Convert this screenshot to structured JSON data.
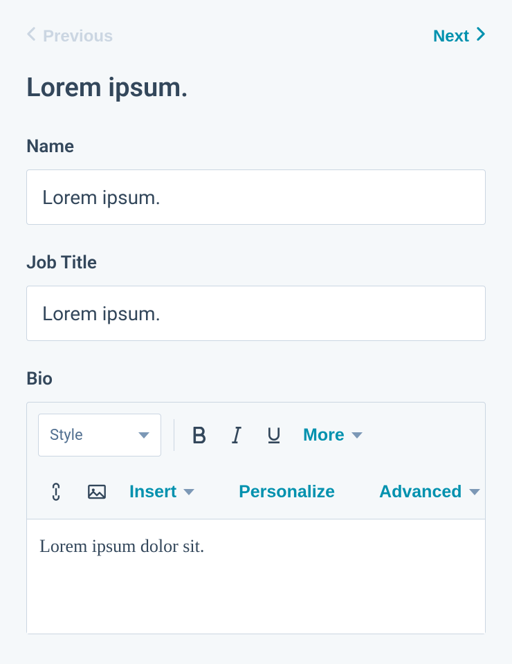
{
  "nav": {
    "previous_label": "Previous",
    "next_label": "Next"
  },
  "page_title": "Lorem ipsum.",
  "fields": {
    "name": {
      "label": "Name",
      "value": "Lorem ipsum."
    },
    "job_title": {
      "label": "Job Title",
      "value": "Lorem ipsum."
    },
    "bio": {
      "label": "Bio",
      "value": "Lorem ipsum dolor sit."
    }
  },
  "editor": {
    "style_label": "Style",
    "more_label": "More",
    "insert_label": "Insert",
    "personalize_label": "Personalize",
    "advanced_label": "Advanced"
  },
  "colors": {
    "accent": "#0091ae",
    "text": "#33475b",
    "muted": "#cbd6e2",
    "label_muted": "#516f90"
  }
}
